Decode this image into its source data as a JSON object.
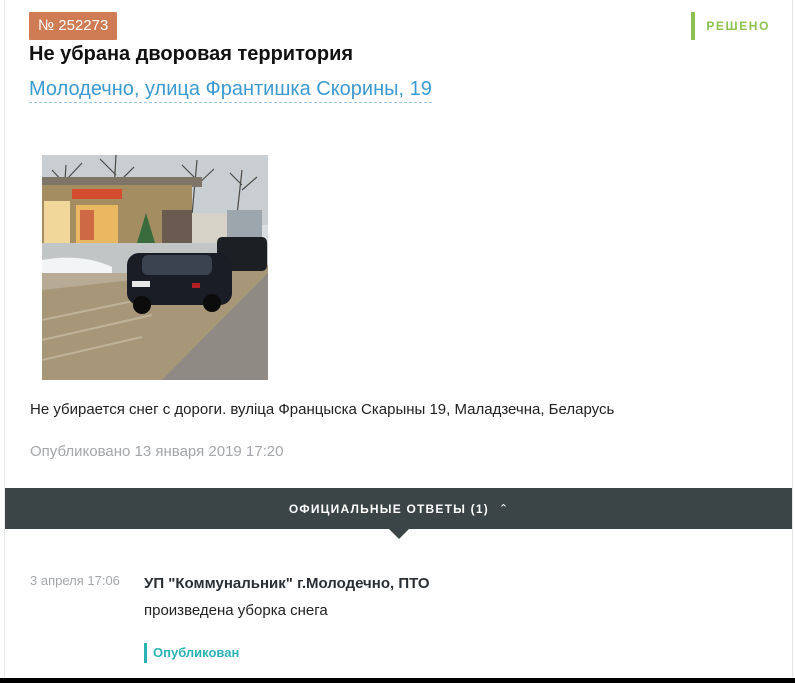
{
  "complaint": {
    "number": "№ 252273",
    "status": "РЕШЕНО",
    "title": "Не убрана дворовая территория",
    "address": "Молодечно, улица Франтишка Скорины, 19",
    "description": "Не убирается снег с дороги. вуліца Францыска Скарыны 19, Маладзечна, Беларусь",
    "published": "Опубликовано 13 января 2019 17:20"
  },
  "answers": {
    "header": "ОФИЦИАЛЬНЫЕ ОТВЕТЫ (1)",
    "toggle_icon": "chevron-up-icon",
    "items": [
      {
        "date": "3 апреля 17:06",
        "org": "УП \"Коммунальник\" г.Молодечно, ПТО",
        "text": "произведена уборка снега",
        "status": "Опубликован"
      }
    ]
  },
  "colors": {
    "badge": "#cf7b54",
    "resolved": "#8cc152",
    "link": "#3d9ad1",
    "bar": "#3b4547",
    "published_answer": "#2bb3b3"
  }
}
